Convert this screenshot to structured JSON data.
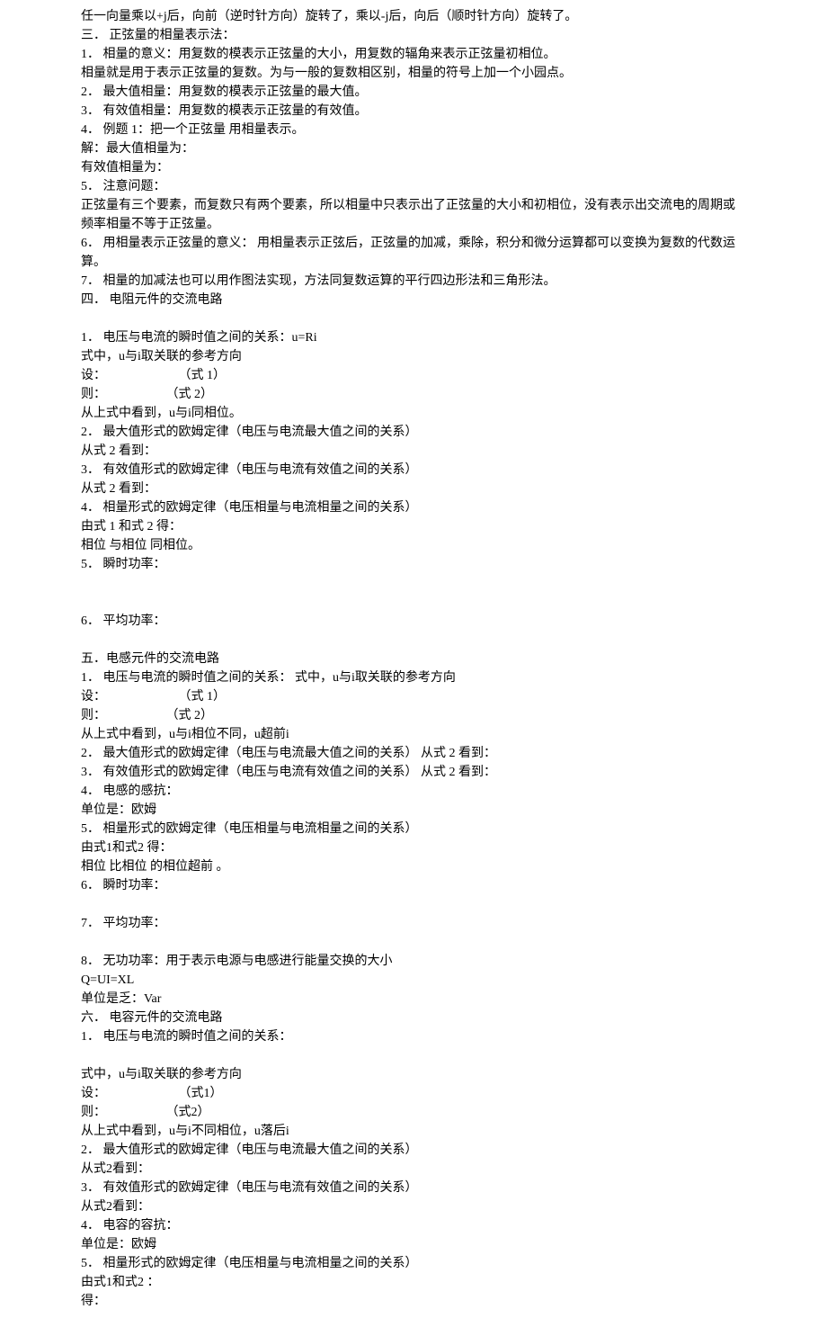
{
  "lines": [
    "任一向量乘以+j后，向前（逆时针方向）旋转了，乘以-j后，向后（顺时针方向）旋转了。",
    "三． 正弦量的相量表示法：",
    "1． 相量的意义：用复数的模表示正弦量的大小，用复数的辐角来表示正弦量初相位。",
    "相量就是用于表示正弦量的复数。为与一般的复数相区别，相量的符号上加一个小园点。",
    "2． 最大值相量：用复数的模表示正弦量的最大值。",
    "3． 有效值相量：用复数的模表示正弦量的有效值。",
    "4． 例题 1：把一个正弦量 用相量表示。",
    "解：最大值相量为：",
    "有效值相量为：",
    "5． 注意问题：",
    "正弦量有三个要素，而复数只有两个要素，所以相量中只表示出了正弦量的大小和初相位，没有表示出交流电的周期或频率相量不等于正弦量。",
    "6． 用相量表示正弦量的意义： 用相量表示正弦后，正弦量的加减，乘除，积分和微分运算都可以变换为复数的代数运算。",
    "7． 相量的加减法也可以用作图法实现，方法同复数运算的平行四边形法和三角形法。",
    "四． 电阻元件的交流电路",
    "",
    "1． 电压与电流的瞬时值之间的关系：u=Ri",
    "式中，u与i取关联的参考方向",
    "设：                       （式 1）",
    "则：                   （式 2）",
    "从上式中看到，u与i同相位。",
    "2． 最大值形式的欧姆定律（电压与电流最大值之间的关系）",
    "从式 2 看到：",
    "3． 有效值形式的欧姆定律（电压与电流有效值之间的关系）",
    "从式 2 看到：",
    "4． 相量形式的欧姆定律（电压相量与电流相量之间的关系）",
    "由式 1 和式 2 得：",
    "相位 与相位 同相位。",
    "5． 瞬时功率：",
    "",
    "",
    "6． 平均功率：",
    "",
    "五．电感元件的交流电路",
    "1． 电压与电流的瞬时值之间的关系： 式中，u与i取关联的参考方向",
    "设：                       （式 1）",
    "则：                   （式 2）",
    "从上式中看到，u与i相位不同，u超前i",
    "2． 最大值形式的欧姆定律（电压与电流最大值之间的关系） 从式 2 看到：",
    "3． 有效值形式的欧姆定律（电压与电流有效值之间的关系） 从式 2 看到：",
    "4． 电感的感抗：",
    "单位是：欧姆",
    "5． 相量形式的欧姆定律（电压相量与电流相量之间的关系）",
    "由式1和式2 得：",
    "相位 比相位 的相位超前 。",
    "6． 瞬时功率：",
    "",
    "7． 平均功率：",
    "",
    "8． 无功功率：用于表示电源与电感进行能量交换的大小",
    "Q=UI=XL",
    "单位是乏：Var",
    "六． 电容元件的交流电路",
    "1． 电压与电流的瞬时值之间的关系：",
    "",
    "式中，u与i取关联的参考方向",
    "设：                       （式1）",
    "则：                   （式2）",
    "从上式中看到，u与i不同相位，u落后i",
    "2． 最大值形式的欧姆定律（电压与电流最大值之间的关系）",
    "从式2看到：",
    "3． 有效值形式的欧姆定律（电压与电流有效值之间的关系）",
    "从式2看到：",
    "4． 电容的容抗：",
    "单位是：欧姆",
    "5． 相量形式的欧姆定律（电压相量与电流相量之间的关系）",
    "由式1和式2 ：",
    "得："
  ]
}
